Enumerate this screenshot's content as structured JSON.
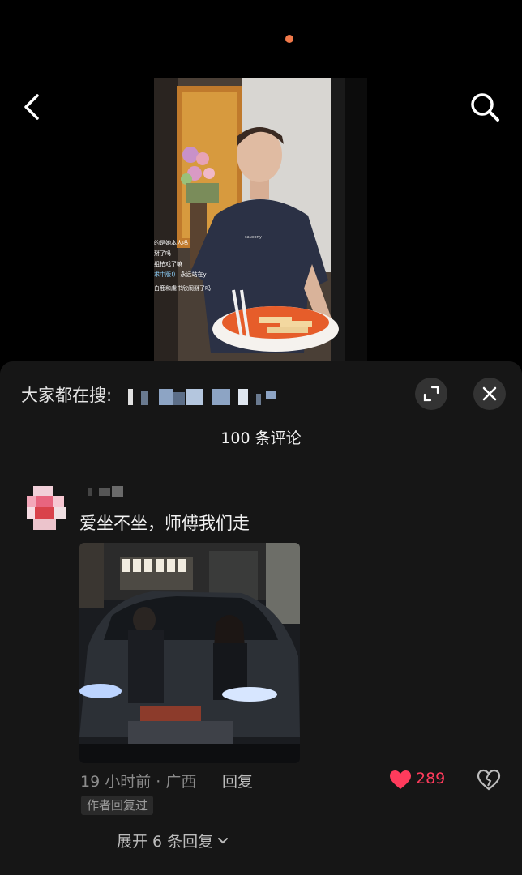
{
  "header": {
    "back_icon": "chevron-left-icon",
    "search_icon": "search-icon",
    "indicator_color": "#f0794a"
  },
  "video": {
    "captions": [
      "的是她本人吗",
      "掰了吗",
      "组拍戏了嘛",
      "求中版!)",
      "永远站在y",
      "白鹿和虞书欣闹掰了吗"
    ],
    "shirt_logo": "saucony"
  },
  "sheet": {
    "trending_label": "大家都在搜:",
    "comment_count": "100 条评论",
    "expand_icon": "expand-icon",
    "close_icon": "close-icon"
  },
  "comment": {
    "text": "爱坐不坐，师傅我们走",
    "time_location": "19 小时前 · 广西",
    "reply_label": "回复",
    "likes": "289",
    "like_color": "#ff3b5c",
    "author_tag": "作者回复过",
    "expand_replies": "展开 6 条回复"
  }
}
